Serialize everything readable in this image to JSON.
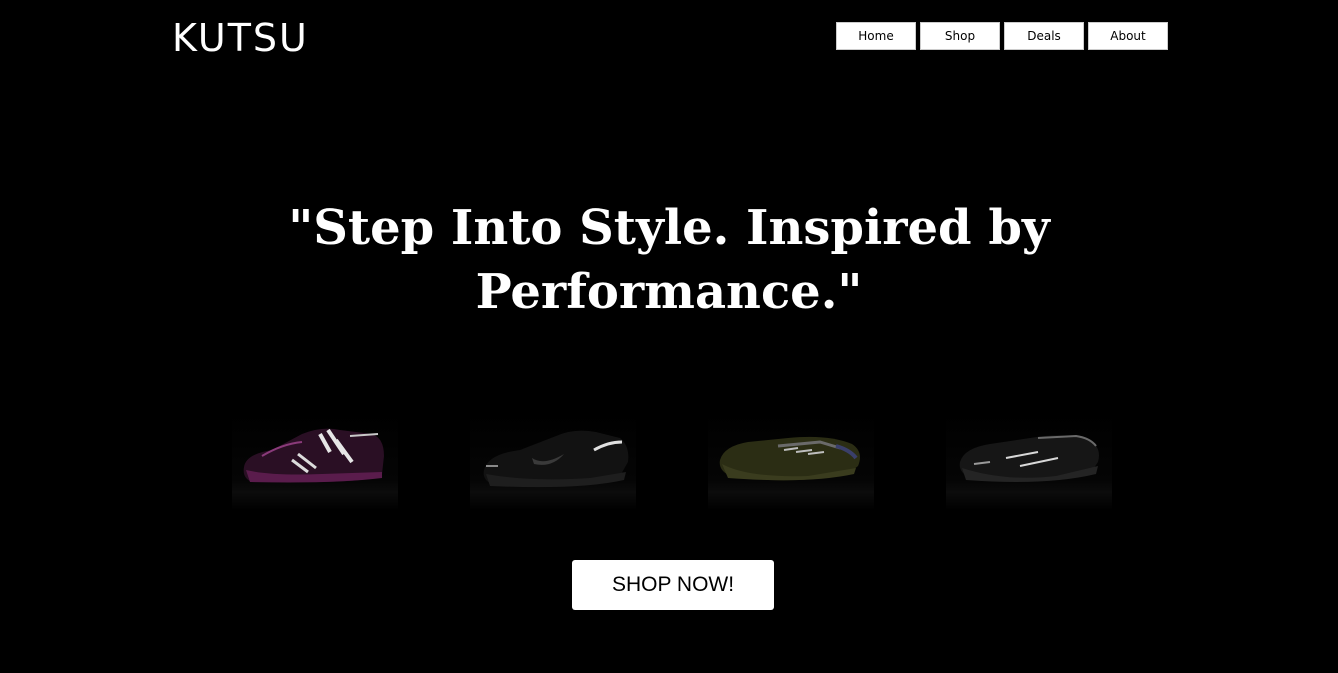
{
  "header": {
    "logo": "KUTSU",
    "nav": [
      "Home",
      "Shop",
      "Deals",
      "About"
    ]
  },
  "hero": {
    "headline": "\"Step Into Style. Inspired by Performance.\"",
    "cta_label": "SHOP NOW!"
  },
  "products": [
    {
      "name": "shoe-1",
      "accent": "#6a2a5c"
    },
    {
      "name": "shoe-2",
      "accent": "#1a1a1a"
    },
    {
      "name": "shoe-3",
      "accent": "#3b3f22"
    },
    {
      "name": "shoe-4",
      "accent": "#1c1c1c"
    }
  ],
  "colors": {
    "background": "#000000",
    "text": "#ffffff",
    "button_bg": "#ffffff",
    "button_text": "#000000"
  }
}
